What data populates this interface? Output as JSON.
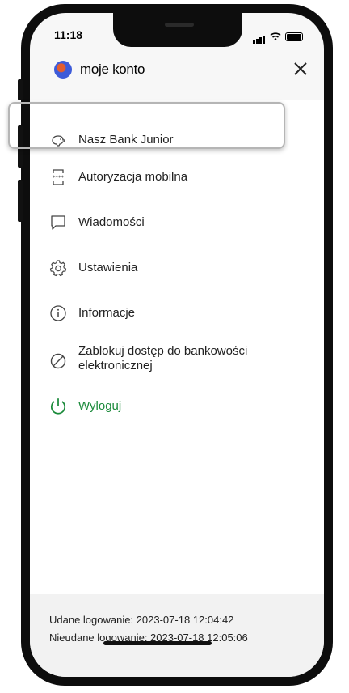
{
  "status_bar": {
    "time": "11:18"
  },
  "header": {
    "title": "moje konto"
  },
  "menu": {
    "items": [
      {
        "label": "Nasz Bank Junior",
        "icon": "piggy-bank-icon"
      },
      {
        "label": "Autoryzacja mobilna",
        "icon": "mobile-authorization-icon"
      },
      {
        "label": "Wiadomości",
        "icon": "message-icon"
      },
      {
        "label": "Ustawienia",
        "icon": "gear-icon"
      },
      {
        "label": "Informacje",
        "icon": "info-icon"
      },
      {
        "label_line1": "Zablokuj dostęp do bankowości",
        "label_line2": "elektronicznej",
        "icon": "block-icon"
      },
      {
        "label": "Wyloguj",
        "icon": "power-icon"
      }
    ]
  },
  "footer": {
    "success_login": "Udane logowanie: 2023-07-18 12:04:42",
    "failed_login": "Nieudane logowanie: 2023-07-18 12:05:06"
  },
  "colors": {
    "accent_green": "#1a8a3a",
    "highlight_border": "#b5b5b5"
  }
}
